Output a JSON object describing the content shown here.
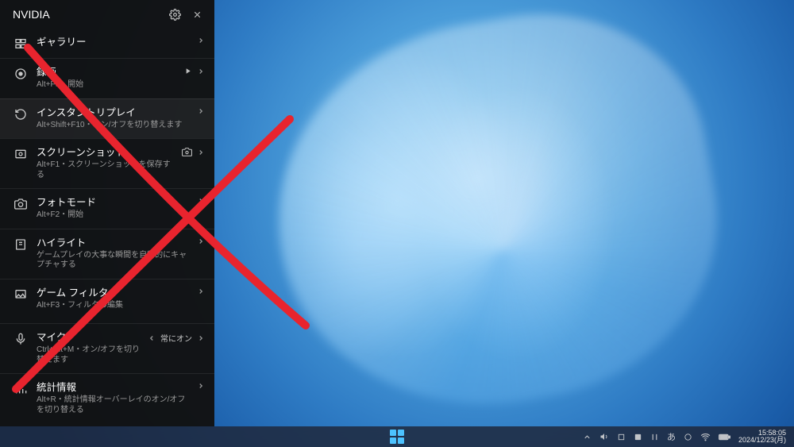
{
  "overlay": {
    "title": "NVIDIA"
  },
  "menu": {
    "gallery": {
      "label": "ギャラリー"
    },
    "record": {
      "label": "録画",
      "sub": "Alt+F9・開始"
    },
    "instant_replay": {
      "label": "インスタントリプレイ",
      "sub": "Alt+Shift+F10・オン/オフを切り替えます"
    },
    "screenshot": {
      "label": "スクリーンショット",
      "sub": "Alt+F1・スクリーンショットを保存する"
    },
    "photo_mode": {
      "label": "フォトモード",
      "sub": "Alt+F2・開始"
    },
    "highlights": {
      "label": "ハイライト",
      "sub": "ゲームプレイの大事な瞬間を自動的にキャプチャする"
    },
    "filter": {
      "label": "ゲーム フィルタ",
      "sub": "Alt+F3・フィルタの編集"
    },
    "mic": {
      "label": "マイク",
      "sub": "Ctrl+Alt+M・オン/オフを切り替えます",
      "status": "常にオン"
    },
    "stats": {
      "label": "統計情報",
      "sub": "Alt+R・統計情報オーバーレイのオン/オフを切り替える"
    }
  },
  "taskbar": {
    "ime": "あ",
    "time": "15:58:05",
    "date": "2024/12/23(月)"
  },
  "colors": {
    "annotation": "#e8242e"
  }
}
